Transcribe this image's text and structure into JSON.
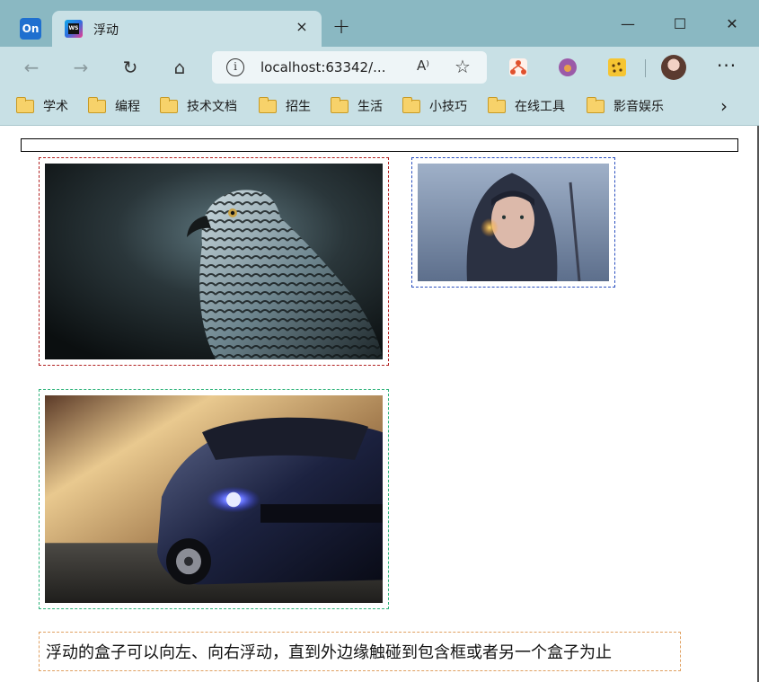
{
  "browser": {
    "pinned_tab_label": "On",
    "tab": {
      "title": "浮动",
      "favicon_label": "WS",
      "close_glyph": "×"
    },
    "new_tab_glyph": "+",
    "window_controls": {
      "minimize": "—",
      "maximize": "☐",
      "close": "✕"
    },
    "toolbar": {
      "back_glyph": "←",
      "forward_glyph": "→",
      "refresh_glyph": "↻",
      "home_glyph": "⌂",
      "url": "localhost:63342/...",
      "read_aloud_glyph": "A⁾",
      "favorite_glyph": "☆",
      "more_glyph": "···"
    },
    "bookmarks": [
      "学术",
      "编程",
      "技术文档",
      "招生",
      "生活",
      "小技巧",
      "在线工具",
      "影音娱乐"
    ],
    "bookmarks_more_glyph": "›"
  },
  "page": {
    "caption": "浮动的盒子可以向左、向右浮动，直到外边缘触碰到包含框或者另一个盒子为止"
  },
  "colors": {
    "chrome_bg": "#8ab8c2",
    "toolbar_bg": "#c8e0e5",
    "eagle_border": "#b22222",
    "warrior_border": "#2a4fbf",
    "car_border": "#2fb37b",
    "caption_border": "#e0a060"
  },
  "icons": [
    "outlook-icon",
    "webstorm-icon",
    "info-icon",
    "read-aloud-icon",
    "favorite-add-icon",
    "extension-sitemap-icon",
    "extension-fox-icon",
    "extension-leopard-icon",
    "folder-icon"
  ]
}
